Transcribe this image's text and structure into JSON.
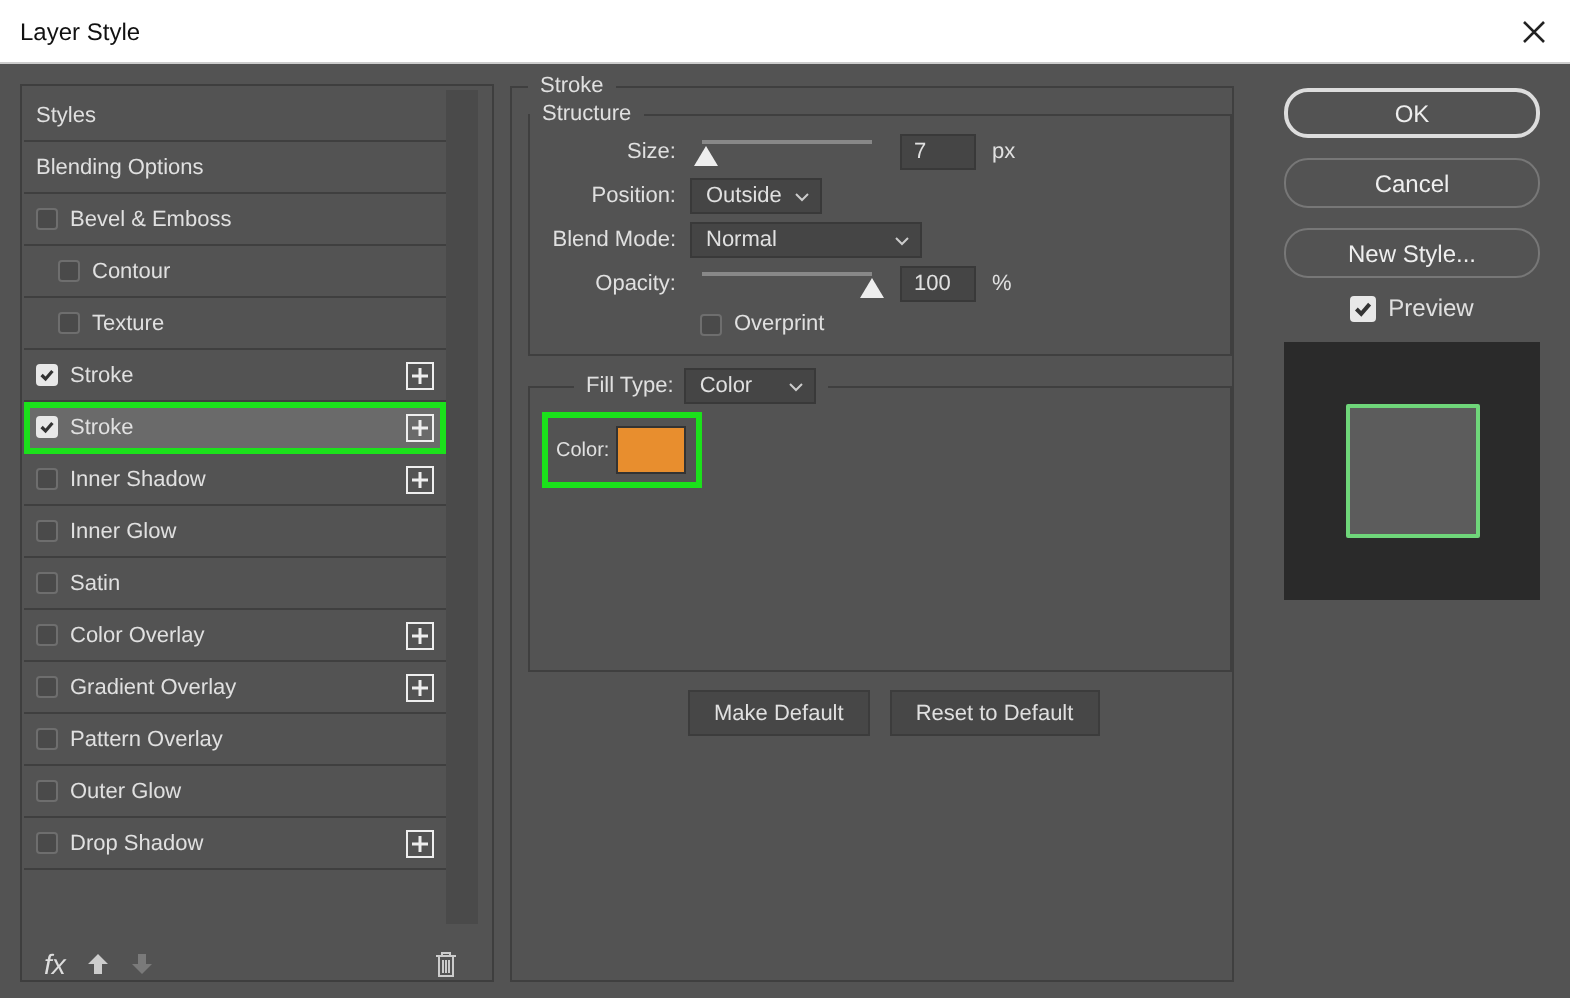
{
  "window": {
    "title": "Layer Style"
  },
  "styles_list": [
    {
      "kind": "header",
      "label": "Styles",
      "selected": false
    },
    {
      "kind": "header",
      "label": "Blending Options",
      "selected": false
    },
    {
      "kind": "effect",
      "label": "Bevel & Emboss",
      "checked": false,
      "selected": false,
      "add_button": false,
      "children": [
        {
          "kind": "effect",
          "label": "Contour",
          "checked": false,
          "selected": false,
          "add_button": false
        },
        {
          "kind": "effect",
          "label": "Texture",
          "checked": false,
          "selected": false,
          "add_button": false
        }
      ]
    },
    {
      "kind": "effect",
      "label": "Stroke",
      "checked": true,
      "selected": false,
      "add_button": true
    },
    {
      "kind": "effect",
      "label": "Stroke",
      "checked": true,
      "selected": true,
      "add_button": true
    },
    {
      "kind": "effect",
      "label": "Inner Shadow",
      "checked": false,
      "selected": false,
      "add_button": true
    },
    {
      "kind": "effect",
      "label": "Inner Glow",
      "checked": false,
      "selected": false,
      "add_button": false
    },
    {
      "kind": "effect",
      "label": "Satin",
      "checked": false,
      "selected": false,
      "add_button": false
    },
    {
      "kind": "effect",
      "label": "Color Overlay",
      "checked": false,
      "selected": false,
      "add_button": true
    },
    {
      "kind": "effect",
      "label": "Gradient Overlay",
      "checked": false,
      "selected": false,
      "add_button": true
    },
    {
      "kind": "effect",
      "label": "Pattern Overlay",
      "checked": false,
      "selected": false,
      "add_button": false
    },
    {
      "kind": "effect",
      "label": "Outer Glow",
      "checked": false,
      "selected": false,
      "add_button": false
    },
    {
      "kind": "effect",
      "label": "Drop Shadow",
      "checked": false,
      "selected": false,
      "add_button": true
    }
  ],
  "list_toolbar": {
    "fx_label": "fx",
    "move_down_disabled": true
  },
  "stroke": {
    "title": "Stroke",
    "structure_title": "Structure",
    "size": {
      "label": "Size:",
      "level": 0.02,
      "value": "7",
      "unit": "px"
    },
    "position": {
      "label": "Position:",
      "value": "Outside"
    },
    "blend_mode": {
      "label": "Blend Mode:",
      "value": "Normal"
    },
    "opacity": {
      "label": "Opacity:",
      "level": 1,
      "value": "100",
      "unit": "%"
    },
    "overprint": {
      "label": "Overprint",
      "checked": false
    },
    "fill_type": {
      "label": "Fill Type:",
      "value": "Color"
    },
    "color": {
      "label": "Color:",
      "color": "#e88e2e",
      "highlighted": true
    }
  },
  "bottom_buttons": [
    "Make Default",
    "Reset to Default"
  ],
  "side_buttons": [
    {
      "label": "OK",
      "default": true
    },
    {
      "label": "Cancel",
      "default": false
    },
    {
      "label": "New Style...",
      "default": false
    }
  ],
  "preview": {
    "label": "Preview",
    "checked": true
  }
}
